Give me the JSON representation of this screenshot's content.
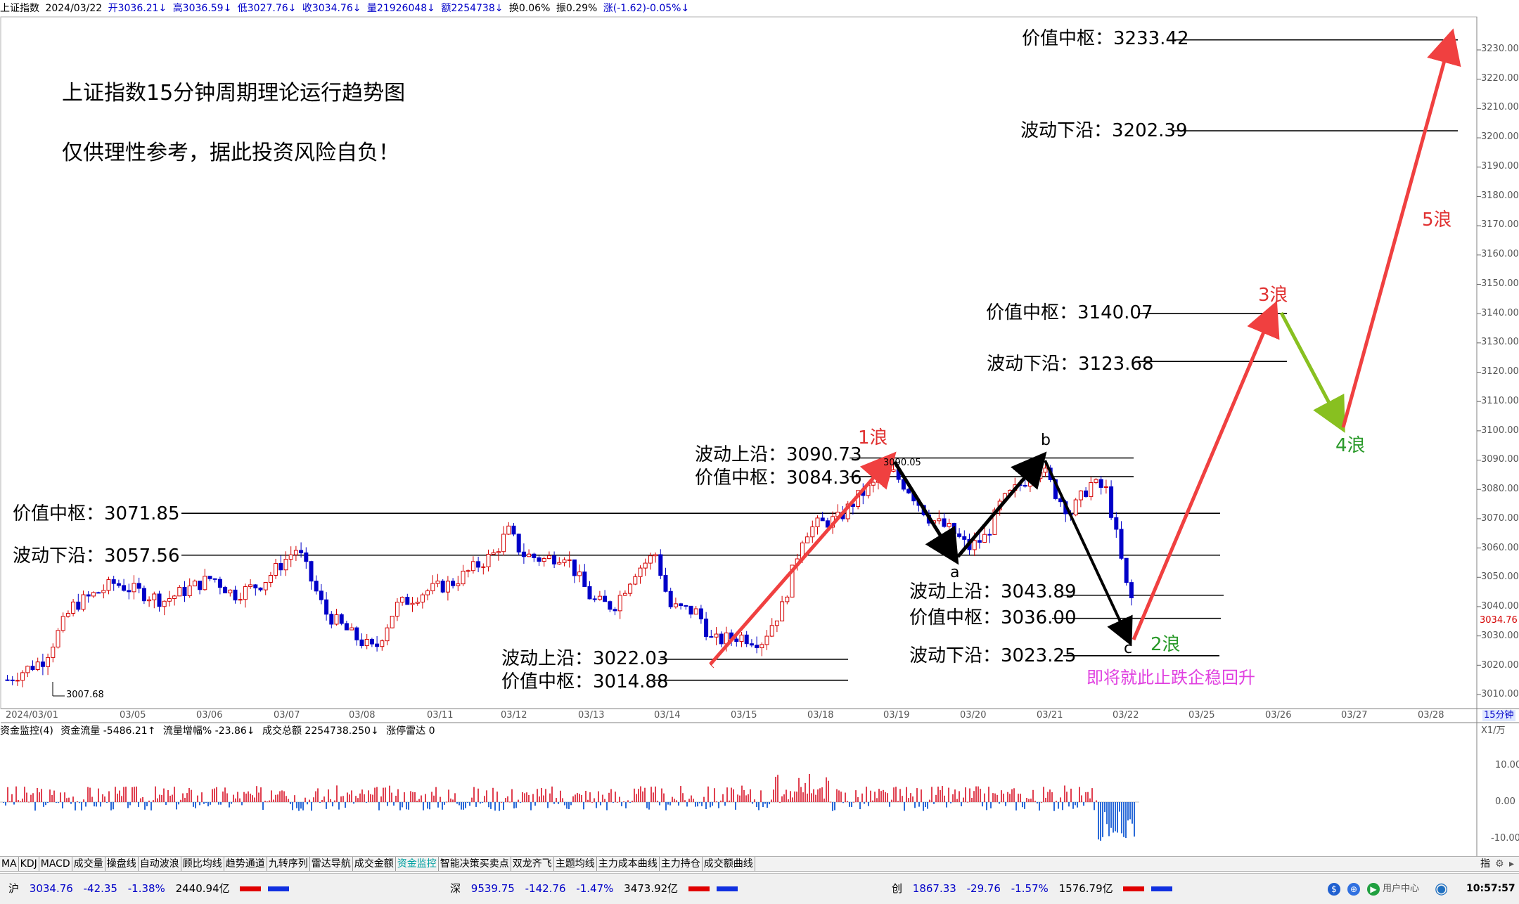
{
  "infobar": {
    "name": "上证指数",
    "date": "2024/03/22",
    "open": "开3036.21↓",
    "high": "高3036.59↓",
    "low": "低3027.76↓",
    "close": "收3034.76↓",
    "volume": "量21926048↓",
    "amount": "额2254738↓",
    "turnover": "换0.06%",
    "amplitude": "振0.29%",
    "change": "涨(-1.62)-0.05%↓"
  },
  "headline": {
    "title": "上证指数15分钟周期理论运行趋势图",
    "disclaimer": "仅供理性参考，据此投资风险自负！"
  },
  "levels": [
    {
      "label": "价值中枢：3233.42",
      "value": 3233.42
    },
    {
      "label": "波动下沿：3202.39",
      "value": 3202.39
    },
    {
      "label": "价值中枢：3140.07",
      "value": 3140.07
    },
    {
      "label": "波动下沿：3123.68",
      "value": 3123.68
    },
    {
      "label": "波动上沿：3090.73",
      "value": 3090.73
    },
    {
      "label": "价值中枢：3084.36",
      "value": 3084.36
    },
    {
      "label": "价值中枢：3071.85",
      "value": 3071.85
    },
    {
      "label": "波动下沿：3057.56",
      "value": 3057.56
    },
    {
      "label": "波动上沿：3043.89",
      "value": 3043.89
    },
    {
      "label": "价值中枢：3036.00",
      "value": 3036.0
    },
    {
      "label": "波动下沿：3023.25",
      "value": 3023.25
    },
    {
      "label": "波动上沿：3022.03",
      "value": 3022.03
    },
    {
      "label": "价值中枢：3014.88",
      "value": 3014.88
    }
  ],
  "waves": {
    "w1": "1浪",
    "w2": "2浪",
    "w3": "3浪",
    "w4": "4浪",
    "w5": "5浪",
    "a": "a",
    "b": "b",
    "c": "c",
    "peak_label": "3090.05",
    "low_label": "3007.68",
    "forecast": "即将就此止跌企稳回升"
  },
  "price_axis": {
    "ticks": [
      "3230.00",
      "3220.00",
      "3210.00",
      "3200.00",
      "3190.00",
      "3180.00",
      "3170.00",
      "3160.00",
      "3150.00",
      "3140.00",
      "3130.00",
      "3120.00",
      "3110.00",
      "3100.00",
      "3090.00",
      "3080.00",
      "3070.00",
      "3060.00",
      "3050.00",
      "3040.00",
      "3030.00",
      "3020.00",
      "3010.00"
    ],
    "current": "3034.76",
    "period": "15分钟"
  },
  "date_axis": [
    "2024/03/01",
    "03/05",
    "03/06",
    "03/07",
    "03/08",
    "03/11",
    "03/12",
    "03/13",
    "03/14",
    "03/15",
    "03/18",
    "03/19",
    "03/20",
    "03/21",
    "03/22",
    "03/25",
    "03/26",
    "03/27",
    "03/28"
  ],
  "subchart": {
    "name": "资金监控(4)",
    "flow": "资金流量 -5486.21↑",
    "growth": "流量增幅% -23.86↓",
    "total": "成交总额 2254738.250↓",
    "limit": "涨停雷达 0",
    "scale_label": "X1/万",
    "ticks": [
      "10.00",
      "0.00",
      "-10.00"
    ]
  },
  "tabs": [
    "MA",
    "KDJ",
    "MACD",
    "成交量",
    "操盘线",
    "自动波浪",
    "顾比均线",
    "趋势通道",
    "九转序列",
    "雷达导航",
    "成交金额",
    "资金监控",
    "智能决策买卖点",
    "双龙齐飞",
    "主题均线",
    "主力成本曲线",
    "主力持仓",
    "成交额曲线"
  ],
  "active_tab": "资金监控",
  "tab_right": "指",
  "status": {
    "sh": {
      "name": "沪",
      "price": "3034.76",
      "change": "-42.35",
      "pct": "-1.38%",
      "amount": "2440.94亿"
    },
    "sz": {
      "name": "深",
      "price": "9539.75",
      "change": "-142.76",
      "pct": "-1.47%",
      "amount": "3473.92亿"
    },
    "cy": {
      "name": "创",
      "price": "1867.33",
      "change": "-29.76",
      "pct": "-1.57%",
      "amount": "1576.79亿"
    },
    "user_center": "用户中心",
    "time": "10:57:57"
  },
  "colors": {
    "up": "#d40000",
    "down": "#0000c8",
    "arrow_red": "#f04040",
    "arrow_green": "#88c020",
    "forecast": "#e040e0"
  }
}
